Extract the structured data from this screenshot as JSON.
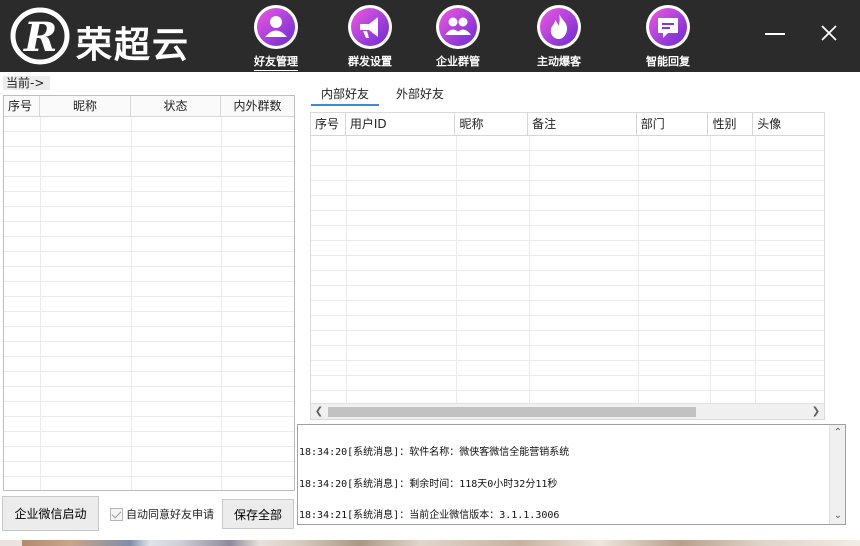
{
  "app": {
    "logo_text": "荣超云",
    "logo_letter": "R"
  },
  "nav": {
    "items": [
      {
        "label": "好友管理",
        "icon": "user-icon",
        "active": true
      },
      {
        "label": "群发设置",
        "icon": "megaphone-icon",
        "active": false
      },
      {
        "label": "企业群管",
        "icon": "group-icon",
        "active": false
      },
      {
        "label": "主动爆客",
        "icon": "flame-icon",
        "active": false
      },
      {
        "label": "智能回复",
        "icon": "chat-bubble-icon",
        "active": false
      }
    ],
    "minimize": "—",
    "close": "X"
  },
  "left": {
    "current_label": "当前->",
    "columns": [
      "序号",
      "昵称",
      "状态",
      "内外群数"
    ],
    "start_button": "企业微信启动",
    "auto_accept_label": "自动同意好友申请",
    "auto_accept_checked": true,
    "save_button": "保存全部"
  },
  "right": {
    "tabs": [
      {
        "label": "内部好友",
        "active": true
      },
      {
        "label": "外部好友",
        "active": false
      }
    ],
    "columns": [
      "序号",
      "用户ID",
      "昵称",
      "备注",
      "部门",
      "性别",
      "头像"
    ]
  },
  "log": {
    "lines": [
      "18:34:20[系统消息]：软件名称：微侠客微信全能营销系统",
      "18:34:20[系统消息]：剩余时间：118天0小时32分11秒",
      "18:34:21[系统消息]：当前企业微信版本：3.1.1.3006"
    ]
  },
  "colors": {
    "header_bg": "#2b2b2b",
    "icon_gradient_start": "#e84fd9",
    "icon_gradient_end": "#6a2bd1",
    "tab_accent": "#3c8ad8"
  }
}
